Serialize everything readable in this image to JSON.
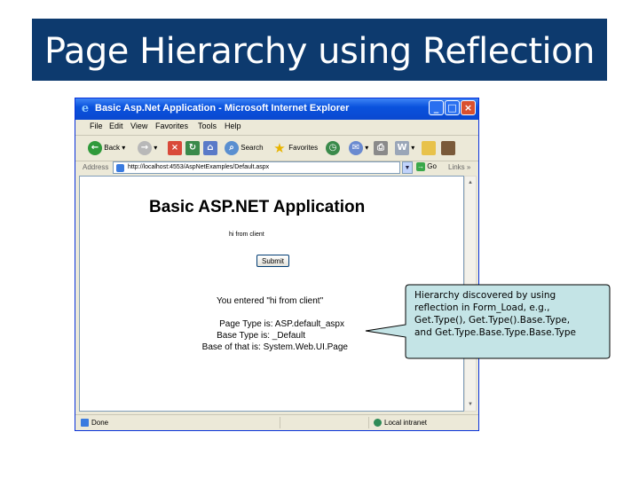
{
  "slide": {
    "title": "Page Hierarchy using Reflection"
  },
  "window": {
    "title": "Basic Asp.Net Application - Microsoft Internet Explorer",
    "menu": [
      "File",
      "Edit",
      "View",
      "Favorites",
      "Tools",
      "Help"
    ],
    "toolbar": {
      "back": "Back",
      "search": "Search",
      "favorites": "Favorites"
    },
    "address": {
      "label": "Address",
      "url": "http://localhost:4553/AspNetExamples/Default.aspx",
      "go": "Go",
      "links": "Links"
    },
    "page": {
      "heading": "Basic ASP.NET Application",
      "input_value": "hi from client",
      "submit": "Submit",
      "entered": "You entered \"hi from client\"",
      "page_type": "Page Type is: ASP.default_aspx",
      "base_type": "Base Type is: _Default",
      "base_of_that": "Base of that is: System.Web.UI.Page"
    },
    "status": {
      "left": "Done",
      "zone": "Local intranet"
    }
  },
  "callout": {
    "lines": [
      "Hierarchy discovered by using",
      "reflection in Form_Load, e.g.,",
      "Get.Type(), Get.Type().Base.Type,",
      "and Get.Type.Base.Type.Base.Type"
    ],
    "fill": "#c4e4e6"
  }
}
